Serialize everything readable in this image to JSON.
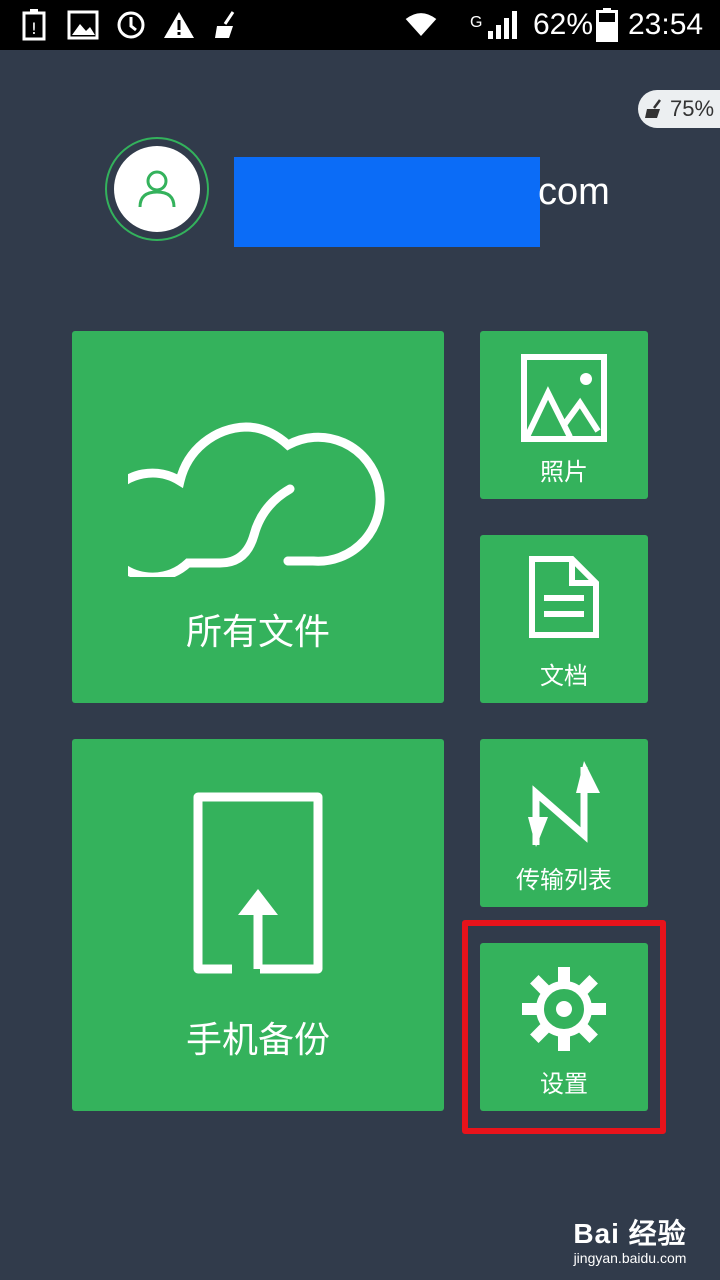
{
  "status_bar": {
    "network": "G",
    "battery": "62%",
    "time": "23:54",
    "icons": [
      "battery-warning-icon",
      "image-icon",
      "sync-icon",
      "alert-icon",
      "cleaner-icon",
      "wifi-icon",
      "signal-icon",
      "battery-icon"
    ]
  },
  "cleaner_badge": {
    "value": "75%",
    "icon": "broom-icon"
  },
  "account": {
    "email_suffix": "com",
    "avatar_icon": "user-icon"
  },
  "tiles": {
    "all_files": {
      "label": "所有文件",
      "icon": "cloud-icon"
    },
    "photos": {
      "label": "照片",
      "icon": "picture-icon"
    },
    "documents": {
      "label": "文档",
      "icon": "document-icon"
    },
    "phone_backup": {
      "label": "手机备份",
      "icon": "phone-upload-icon"
    },
    "transfer_list": {
      "label": "传输列表",
      "icon": "transfer-icon"
    },
    "settings": {
      "label": "设置",
      "icon": "gear-icon"
    }
  },
  "colors": {
    "background": "#313b4b",
    "tile": "#34b25c",
    "highlight": "#e8131b",
    "email_mask": "#0b6cf7"
  },
  "watermark": {
    "logo": "Bai 经验",
    "url": "jingyan.baidu.com"
  }
}
